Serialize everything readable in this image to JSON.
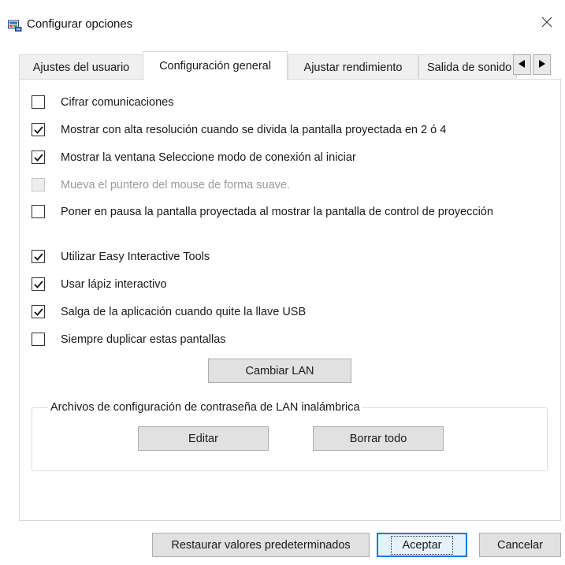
{
  "window": {
    "title": "Configurar opciones",
    "icon": "projector-app-icon",
    "close_icon": "close-icon"
  },
  "tabs": [
    {
      "label": "Ajustes del usuario",
      "active": false
    },
    {
      "label": "Configuración general",
      "active": true
    },
    {
      "label": "Ajustar rendimiento",
      "active": false
    },
    {
      "label": "Salida de sonido",
      "active": false
    }
  ],
  "tab_scroll": {
    "left_icon": "triangle-left-icon",
    "right_icon": "triangle-right-icon"
  },
  "options": [
    {
      "label": "Cifrar comunicaciones",
      "checked": false,
      "enabled": true
    },
    {
      "label": "Mostrar con alta resolución cuando se divida la pantalla proyectada en 2 ó 4",
      "checked": true,
      "enabled": true
    },
    {
      "label": "Mostrar la ventana Seleccione modo de conexión al iniciar",
      "checked": true,
      "enabled": true
    },
    {
      "label": "Mueva el puntero del mouse de forma suave.",
      "checked": false,
      "enabled": false
    },
    {
      "label": "Poner en pausa la pantalla proyectada al mostrar la pantalla de control de proyección",
      "checked": false,
      "enabled": true
    },
    {
      "label": "Utilizar Easy Interactive Tools",
      "checked": true,
      "enabled": true
    },
    {
      "label": "Usar lápiz interactivo",
      "checked": true,
      "enabled": true
    },
    {
      "label": "Salga de la aplicación cuando quite la llave USB",
      "checked": true,
      "enabled": true
    },
    {
      "label": "Siempre duplicar estas pantallas",
      "checked": false,
      "enabled": true
    }
  ],
  "buttons": {
    "change_lan": "Cambiar LAN",
    "edit": "Editar",
    "delete_all": "Borrar todo",
    "restore_defaults": "Restaurar valores predeterminados",
    "accept": "Aceptar",
    "cancel": "Cancelar"
  },
  "wireless_group": {
    "legend": "Archivos de configuración de contraseña de LAN inalámbrica"
  },
  "colors": {
    "default_button_border": "#0078d7",
    "default_button_fill": "#e5f1fb",
    "button_fill": "#e1e1e1"
  }
}
